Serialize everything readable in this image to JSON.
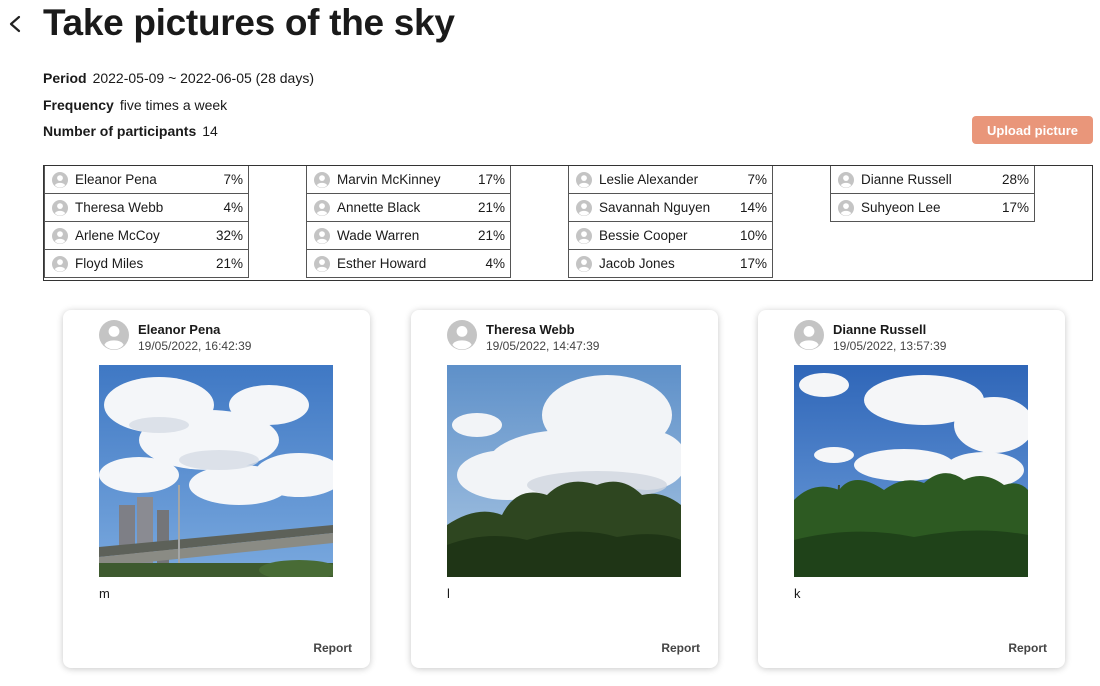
{
  "header": {
    "title": "Take pictures of the sky",
    "back_icon": "chevron-left-icon"
  },
  "info": {
    "period_label": "Period",
    "period_value": "2022-05-09 ~ 2022-06-05 (28 days)",
    "frequency_label": "Frequency",
    "frequency_value": "five times a week",
    "participants_label": "Number of participants",
    "participants_value": "14"
  },
  "upload_button": {
    "label": "Upload picture",
    "color": "#e9967a"
  },
  "participants": [
    [
      {
        "name": "Eleanor Pena",
        "pct": "7%"
      },
      {
        "name": "Theresa Webb",
        "pct": "4%"
      },
      {
        "name": "Arlene McCoy",
        "pct": "32%"
      },
      {
        "name": "Floyd Miles",
        "pct": "21%"
      }
    ],
    [
      {
        "name": "Marvin McKinney",
        "pct": "17%"
      },
      {
        "name": "Annette Black",
        "pct": "21%"
      },
      {
        "name": "Wade Warren",
        "pct": "21%"
      },
      {
        "name": "Esther Howard",
        "pct": "4%"
      }
    ],
    [
      {
        "name": "Leslie Alexander",
        "pct": "7%"
      },
      {
        "name": "Savannah Nguyen",
        "pct": "14%"
      },
      {
        "name": "Bessie Cooper",
        "pct": "10%"
      },
      {
        "name": "Jacob Jones",
        "pct": "17%"
      }
    ],
    [
      {
        "name": "Dianne Russell",
        "pct": "28%"
      },
      {
        "name": "Suhyeon Lee",
        "pct": "17%"
      }
    ]
  ],
  "posts": [
    {
      "author": "Eleanor Pena",
      "date": "19/05/2022, 16:42:39",
      "caption": "m",
      "report_label": "Report"
    },
    {
      "author": "Theresa Webb",
      "date": "19/05/2022, 14:47:39",
      "caption": "l",
      "report_label": "Report"
    },
    {
      "author": "Dianne Russell",
      "date": "19/05/2022, 13:57:39",
      "caption": "k",
      "report_label": "Report"
    }
  ]
}
